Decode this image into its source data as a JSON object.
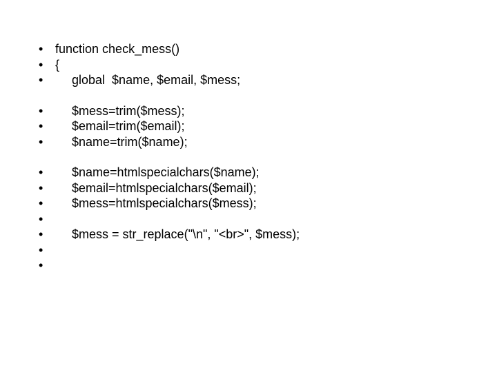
{
  "bullet_char": "•",
  "lines": [
    {
      "group": 0,
      "indent": 0,
      "text": "function check_mess()"
    },
    {
      "group": 0,
      "indent": 0,
      "text": "{"
    },
    {
      "group": 0,
      "indent": 1,
      "text": "global  $name, $email, $mess;"
    },
    {
      "group": 1,
      "indent": 1,
      "text": "$mess=trim($mess);"
    },
    {
      "group": 1,
      "indent": 1,
      "text": "$email=trim($email);"
    },
    {
      "group": 1,
      "indent": 1,
      "text": "$name=trim($name);"
    },
    {
      "group": 2,
      "indent": 1,
      "text": "$name=htmlspecialchars($name);"
    },
    {
      "group": 2,
      "indent": 1,
      "text": "$email=htmlspecialchars($email);"
    },
    {
      "group": 2,
      "indent": 1,
      "text": "$mess=htmlspecialchars($mess);"
    },
    {
      "group": 2,
      "indent": 1,
      "text": ""
    },
    {
      "group": 2,
      "indent": 1,
      "text": "$mess = str_replace(\"\\n\", \"<br>\", $mess);"
    },
    {
      "group": 2,
      "indent": 1,
      "text": ""
    },
    {
      "group": 2,
      "indent": 1,
      "text": ""
    }
  ]
}
